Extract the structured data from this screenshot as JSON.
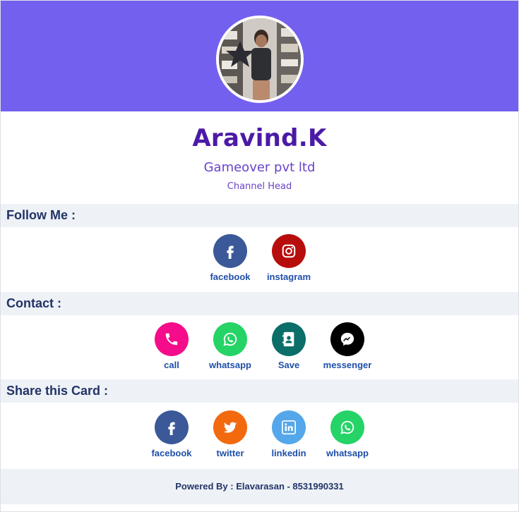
{
  "profile": {
    "name": "Aravind.K",
    "company": "Gameover pvt ltd",
    "role": "Channel Head"
  },
  "follow": {
    "title": "Follow Me :",
    "items": [
      {
        "label": "facebook",
        "icon": "facebook-icon",
        "color": "#3b5998"
      },
      {
        "label": "instagram",
        "icon": "instagram-icon",
        "color": "#b80d0d"
      }
    ]
  },
  "contact": {
    "title": "Contact :",
    "items": [
      {
        "label": "call",
        "icon": "phone-icon",
        "color": "#f50c8a"
      },
      {
        "label": "whatsapp",
        "icon": "whatsapp-icon",
        "color": "#25d366"
      },
      {
        "label": "Save",
        "icon": "contact-book-icon",
        "color": "#0b6e68"
      },
      {
        "label": "messenger",
        "icon": "messenger-icon",
        "color": "#000000"
      }
    ]
  },
  "share": {
    "title": "Share this Card :",
    "items": [
      {
        "label": "facebook",
        "icon": "facebook-icon",
        "color": "#3b5998"
      },
      {
        "label": "twitter",
        "icon": "twitter-icon",
        "color": "#f3690e"
      },
      {
        "label": "linkedin",
        "icon": "linkedin-icon",
        "color": "#54a7ea"
      },
      {
        "label": "whatsapp",
        "icon": "whatsapp-icon",
        "color": "#25d366"
      }
    ]
  },
  "footer": {
    "text": "Powered By : Elavarasan - 8531990331"
  },
  "theme": {
    "header": "#7460ee",
    "name": "#4b1aa6",
    "subtitle": "#6a42c8",
    "section_bg": "#eef2f7",
    "label": "#1f4fa8"
  }
}
